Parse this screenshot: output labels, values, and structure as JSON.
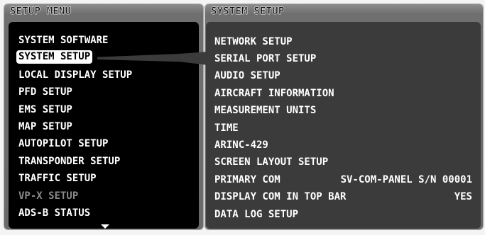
{
  "left_panel": {
    "title": "SETUP MENU",
    "items": [
      {
        "label": "SYSTEM SOFTWARE"
      },
      {
        "label": "SYSTEM SETUP"
      },
      {
        "label": "LOCAL DISPLAY SETUP"
      },
      {
        "label": "PFD SETUP"
      },
      {
        "label": "EMS SETUP"
      },
      {
        "label": "MAP SETUP"
      },
      {
        "label": "AUTOPILOT SETUP"
      },
      {
        "label": "TRANSPONDER SETUP"
      },
      {
        "label": "TRAFFIC SETUP"
      },
      {
        "label": "VP-X SETUP"
      },
      {
        "label": "ADS-B STATUS"
      }
    ],
    "selected_item": "SYSTEM SETUP",
    "disabled_item": "VP-X SETUP"
  },
  "right_panel": {
    "title": "SYSTEM SETUP",
    "items": [
      {
        "label": "NETWORK SETUP"
      },
      {
        "label": "SERIAL PORT SETUP"
      },
      {
        "label": "AUDIO SETUP"
      },
      {
        "label": "AIRCRAFT INFORMATION"
      },
      {
        "label": "MEASUREMENT UNITS"
      },
      {
        "label": "TIME"
      },
      {
        "label": "ARINC-429"
      },
      {
        "label": "SCREEN LAYOUT SETUP"
      },
      {
        "label": "PRIMARY COM",
        "value": "SV-COM-PANEL S/N 00001"
      },
      {
        "label": "DISPLAY COM IN TOP BAR",
        "value": "YES"
      },
      {
        "label": "DATA LOG SETUP"
      }
    ]
  },
  "colors": {
    "frame": "#6f6f6f",
    "left_background": "#000000",
    "right_background": "#3b3b3b",
    "text": "#ffffff",
    "disabled_text": "#8a8a8a",
    "selected_background": "#ffffff"
  },
  "icons": {
    "scroll": "triangle-down-icon"
  }
}
